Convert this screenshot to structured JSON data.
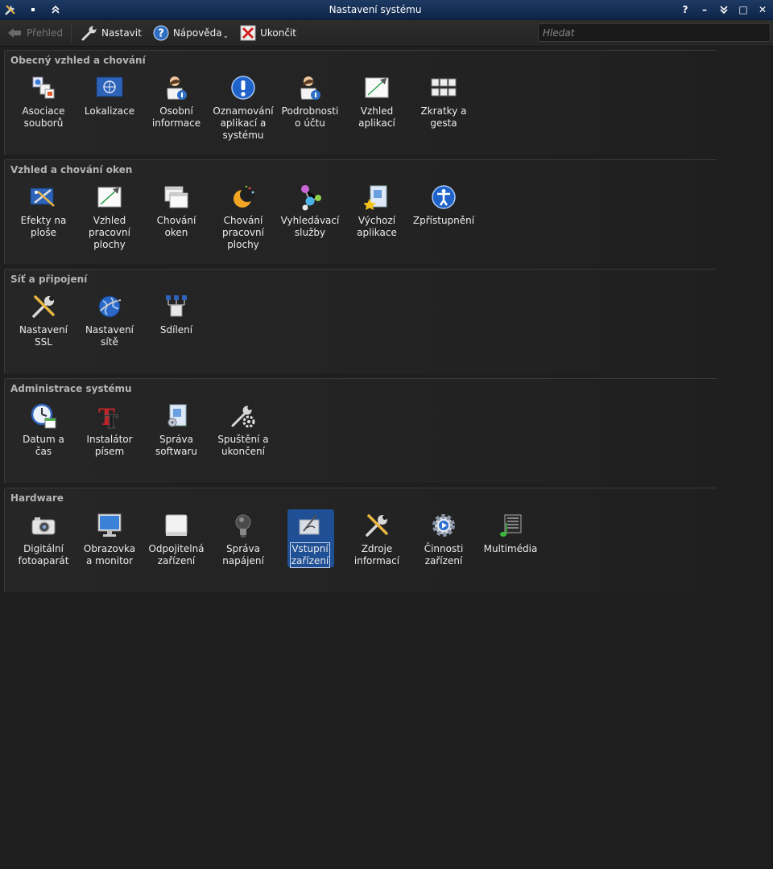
{
  "window": {
    "title": "Nastavení systému",
    "controls": [
      "?",
      "–",
      "⌄",
      "□",
      "✕"
    ]
  },
  "toolbar": {
    "back_label": "Přehled",
    "configure_label": "Nastavit",
    "help_label": "Nápověda",
    "quit_label": "Ukončit",
    "search_placeholder": "Hledat"
  },
  "sections": [
    {
      "title": "Obecný vzhled a chování",
      "items": [
        {
          "label": "Asociace\nsouborů",
          "icon": "file-associations-icon"
        },
        {
          "label": "Lokalizace",
          "icon": "flag-icon"
        },
        {
          "label": "Osobní\ninformace",
          "icon": "user-info-icon"
        },
        {
          "label": "Oznamování\naplikací a\nsystému",
          "icon": "notification-icon"
        },
        {
          "label": "Podrobnosti\no účtu",
          "icon": "account-icon"
        },
        {
          "label": "Vzhled\naplikací",
          "icon": "appearance-icon"
        },
        {
          "label": "Zkratky a\ngesta",
          "icon": "keyboard-icon"
        }
      ]
    },
    {
      "title": "Vzhled a chování oken",
      "items": [
        {
          "label": "Efekty na\nploše",
          "icon": "desktop-effects-icon"
        },
        {
          "label": "Vzhled\npracovní\nplochy",
          "icon": "workspace-appearance-icon"
        },
        {
          "label": "Chování\noken",
          "icon": "window-behavior-icon"
        },
        {
          "label": "Chování\npracovní\nplochy",
          "icon": "moon-icon"
        },
        {
          "label": "Vyhledávací\nslužby",
          "icon": "search-services-icon"
        },
        {
          "label": "Výchozí\naplikace",
          "icon": "default-apps-icon"
        },
        {
          "label": "Zpřístupnění",
          "icon": "accessibility-icon"
        }
      ]
    },
    {
      "title": "Síť a připojení",
      "items": [
        {
          "label": "Nastavení\nSSL",
          "icon": "tools-icon"
        },
        {
          "label": "Nastavení\nsítě",
          "icon": "globe-icon"
        },
        {
          "label": "Sdílení",
          "icon": "network-share-icon"
        }
      ]
    },
    {
      "title": "Administrace systému",
      "items": [
        {
          "label": "Datum a\nčas",
          "icon": "clock-icon"
        },
        {
          "label": "Instalátor\npísem",
          "icon": "font-icon"
        },
        {
          "label": "Správa\nsoftwaru",
          "icon": "software-icon"
        },
        {
          "label": "Spuštění a\nukončení",
          "icon": "startup-icon"
        }
      ]
    },
    {
      "title": "Hardware",
      "items": [
        {
          "label": "Digitální\nfotoaparát",
          "icon": "camera-icon"
        },
        {
          "label": "Obrazovka\na monitor",
          "icon": "monitor-icon"
        },
        {
          "label": "Odpojitelná\nzařízení",
          "icon": "removable-drive-icon"
        },
        {
          "label": "Správa\nnapájení",
          "icon": "bulb-icon"
        },
        {
          "label": "Vstupní\nzařízení",
          "icon": "input-devices-icon",
          "selected": true
        },
        {
          "label": "Zdroje\ninformací",
          "icon": "info-sources-icon"
        },
        {
          "label": "Činnosti\nzařízení",
          "icon": "device-actions-icon"
        },
        {
          "label": "Multimédia",
          "icon": "multimedia-icon"
        }
      ]
    }
  ]
}
